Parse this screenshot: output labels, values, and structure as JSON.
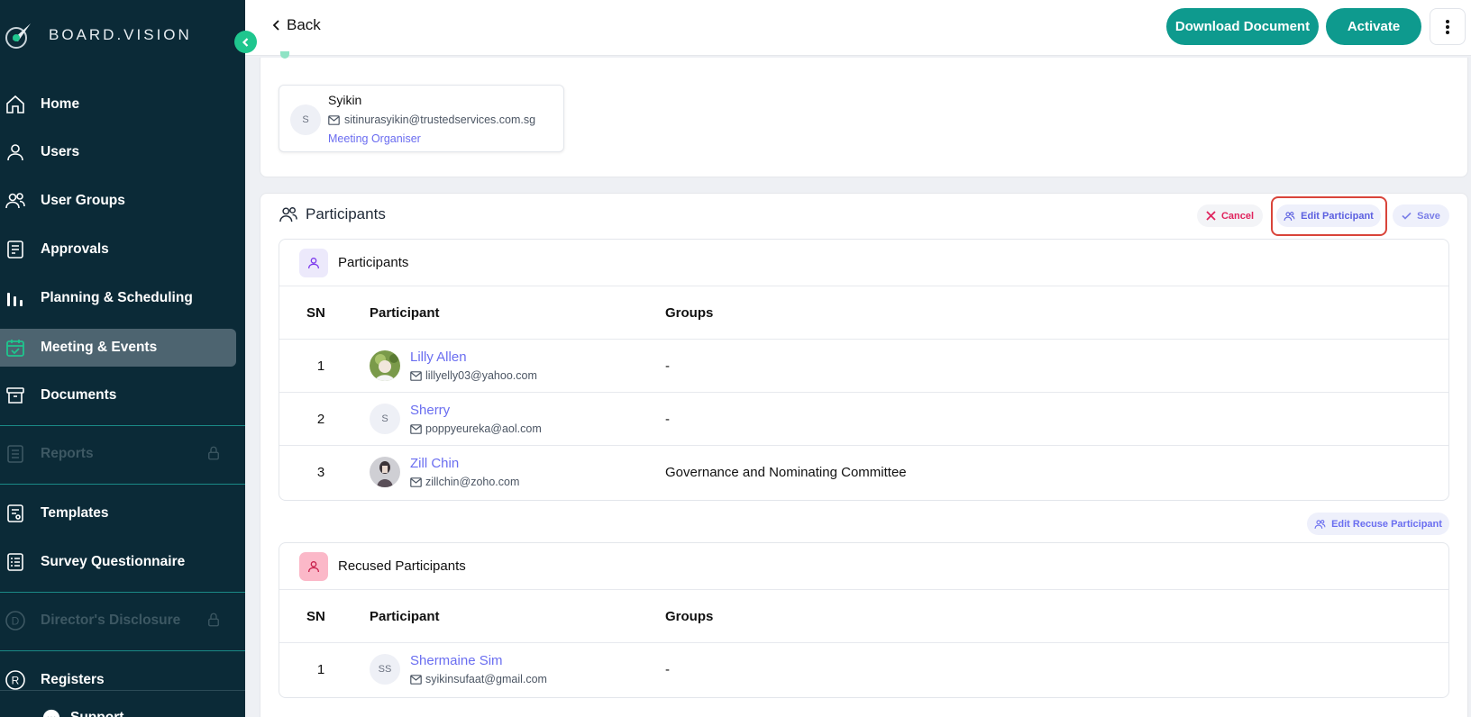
{
  "sidebar": {
    "brand": "BOARD.VISION",
    "items": [
      {
        "label": "Home",
        "icon": "home-icon"
      },
      {
        "label": "Users",
        "icon": "user-icon"
      },
      {
        "label": "User Groups",
        "icon": "users-icon"
      },
      {
        "label": "Approvals",
        "icon": "approvals-icon"
      },
      {
        "label": "Planning & Scheduling",
        "icon": "bar-chart-icon"
      },
      {
        "label": "Meeting & Events",
        "icon": "calendar-check-icon",
        "active": true
      },
      {
        "label": "Documents",
        "icon": "archive-icon"
      },
      {
        "label": "Reports",
        "icon": "report-icon",
        "disabled": true
      },
      {
        "label": "Templates",
        "icon": "template-icon"
      },
      {
        "label": "Survey Questionnaire",
        "icon": "survey-icon"
      },
      {
        "label": "Director's Disclosure",
        "icon": "d-circle-icon",
        "disabled": true
      },
      {
        "label": "Registers",
        "icon": "r-circle-icon"
      },
      {
        "label": "Support",
        "icon": "chat-icon"
      }
    ]
  },
  "topbar": {
    "back_label": "Back",
    "download_label": "Download Document",
    "activate_label": "Activate"
  },
  "organiser": {
    "initial": "S",
    "name": "Syikin",
    "email": "sitinurasyikin@trustedservices.com.sg",
    "role": "Meeting Organiser"
  },
  "participants_section": {
    "title": "Participants",
    "cancel_label": "Cancel",
    "edit_label": "Edit Participant",
    "save_label": "Save",
    "edit_recuse_label": "Edit Recuse Participant"
  },
  "participants_table": {
    "title": "Participants",
    "columns": [
      "SN",
      "Participant",
      "Groups"
    ],
    "rows": [
      {
        "sn": "1",
        "name": "Lilly Allen",
        "email": "lillyelly03@yahoo.com",
        "groups": "-",
        "avatar": "photo"
      },
      {
        "sn": "2",
        "name": "Sherry",
        "email": "poppyeureka@aol.com",
        "groups": "-",
        "avatar": "S"
      },
      {
        "sn": "3",
        "name": "Zill Chin",
        "email": "zillchin@zoho.com",
        "groups": "Governance and Nominating Committee",
        "avatar": "photo"
      }
    ]
  },
  "recused_table": {
    "title": "Recused Participants",
    "columns": [
      "SN",
      "Participant",
      "Groups"
    ],
    "rows": [
      {
        "sn": "1",
        "name": "Shermaine Sim",
        "email": "syikinsufaat@gmail.com",
        "groups": "-",
        "avatar": "SS"
      }
    ]
  },
  "colors": {
    "sidebar_bg": "#0b2a37",
    "primary": "#0e9a8e",
    "accent": "#6a6ef0",
    "danger": "#e0245e",
    "highlight": "#d9443a"
  }
}
